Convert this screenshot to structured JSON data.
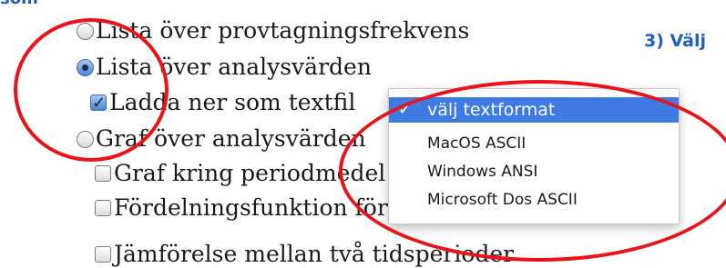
{
  "headings": {
    "cut_top": "som",
    "step": "3) Välj"
  },
  "options": {
    "sample_freq": "Lista över provtagningsfrekvens",
    "analysis_values": "Lista över analysvärden",
    "download_text": "Ladda ner som textfil",
    "graph_values": "Graf över analysvärden",
    "graph_period": "Graf kring periodmedel",
    "distribution": "Fördelningsfunktion för stickprov",
    "partial_bottom": "Jämförelse mellan två tidsperioder"
  },
  "dropdown": {
    "selected": "välj textformat",
    "items": [
      "MacOS ASCII",
      "Windows ANSI",
      "Microsoft Dos ASCII"
    ]
  },
  "colors": {
    "heading": "#1f5fbf",
    "highlight": "#3d7ae2",
    "annotation": "#e8141a"
  }
}
